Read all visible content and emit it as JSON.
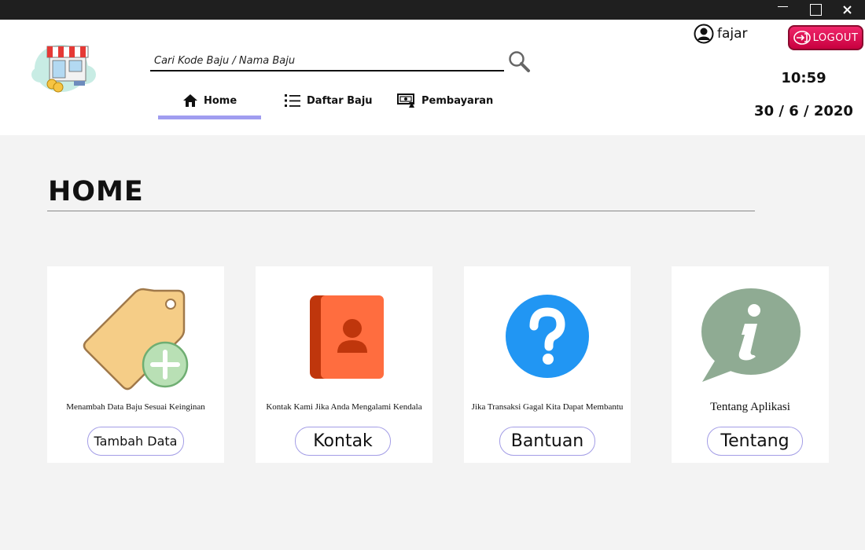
{
  "titlebar": {
    "minimize": "minimize",
    "maximize": "maximize",
    "close": "✕"
  },
  "search": {
    "placeholder": "Cari Kode Baju / Nama Baju"
  },
  "nav": {
    "home": "Home",
    "daftar": "Daftar Baju",
    "pembayaran": "Pembayaran",
    "active": "Home"
  },
  "user": {
    "name": "fajar",
    "logout_label": "LOGOUT"
  },
  "clock": {
    "time": "10:59",
    "date": "30 / 6 / 2020"
  },
  "main": {
    "title": "HOME"
  },
  "cards": [
    {
      "description": "Menambah Data Baju Sesuai Keinginan",
      "button": "Tambah Data",
      "icon": "price-tag-add-icon"
    },
    {
      "description": "Kontak Kami Jika Anda Mengalami Kendala",
      "button": "Kontak",
      "icon": "contact-book-icon"
    },
    {
      "description": "Jika Transaksi Gagal Kita Dapat Membantu",
      "button": "Bantuan",
      "icon": "help-question-icon"
    },
    {
      "description": "Tentang Aplikasi",
      "button": "Tentang",
      "icon": "info-bubble-icon"
    }
  ],
  "colors": {
    "accent": "#a09df0",
    "logout": "#e0195a",
    "tag": "#f5cd87",
    "plus": "#b9e0b5",
    "book": "#ff6d3f",
    "book_spine": "#bf360c",
    "help": "#2196f3",
    "info": "#8fab93"
  }
}
